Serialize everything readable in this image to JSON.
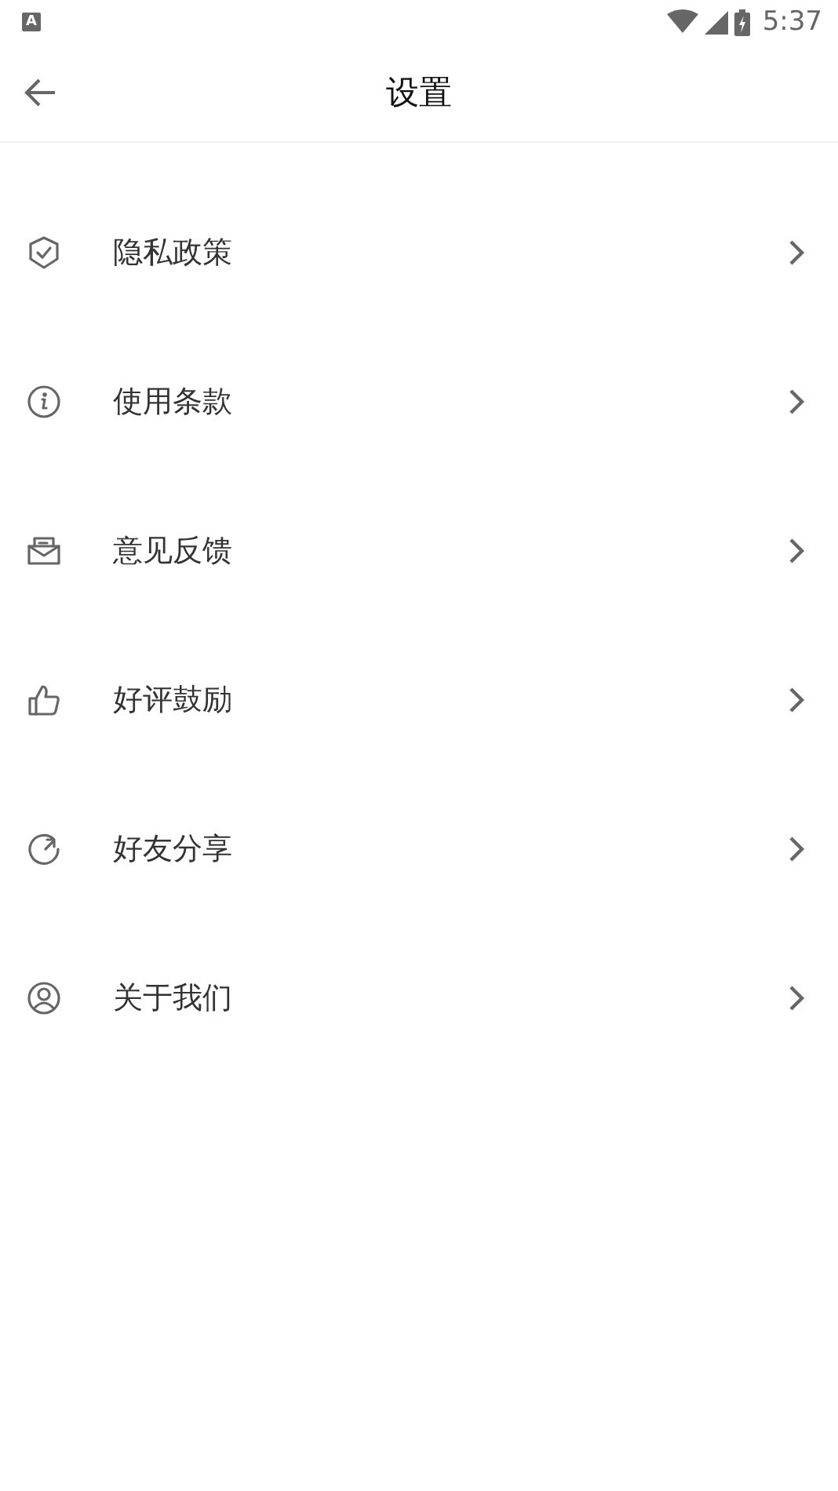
{
  "status_bar": {
    "notification": "A",
    "time": "5:37"
  },
  "header": {
    "title": "设置"
  },
  "items": [
    {
      "label": "隐私政策"
    },
    {
      "label": "使用条款"
    },
    {
      "label": "意见反馈"
    },
    {
      "label": "好评鼓励"
    },
    {
      "label": "好友分享"
    },
    {
      "label": "关于我们"
    }
  ]
}
